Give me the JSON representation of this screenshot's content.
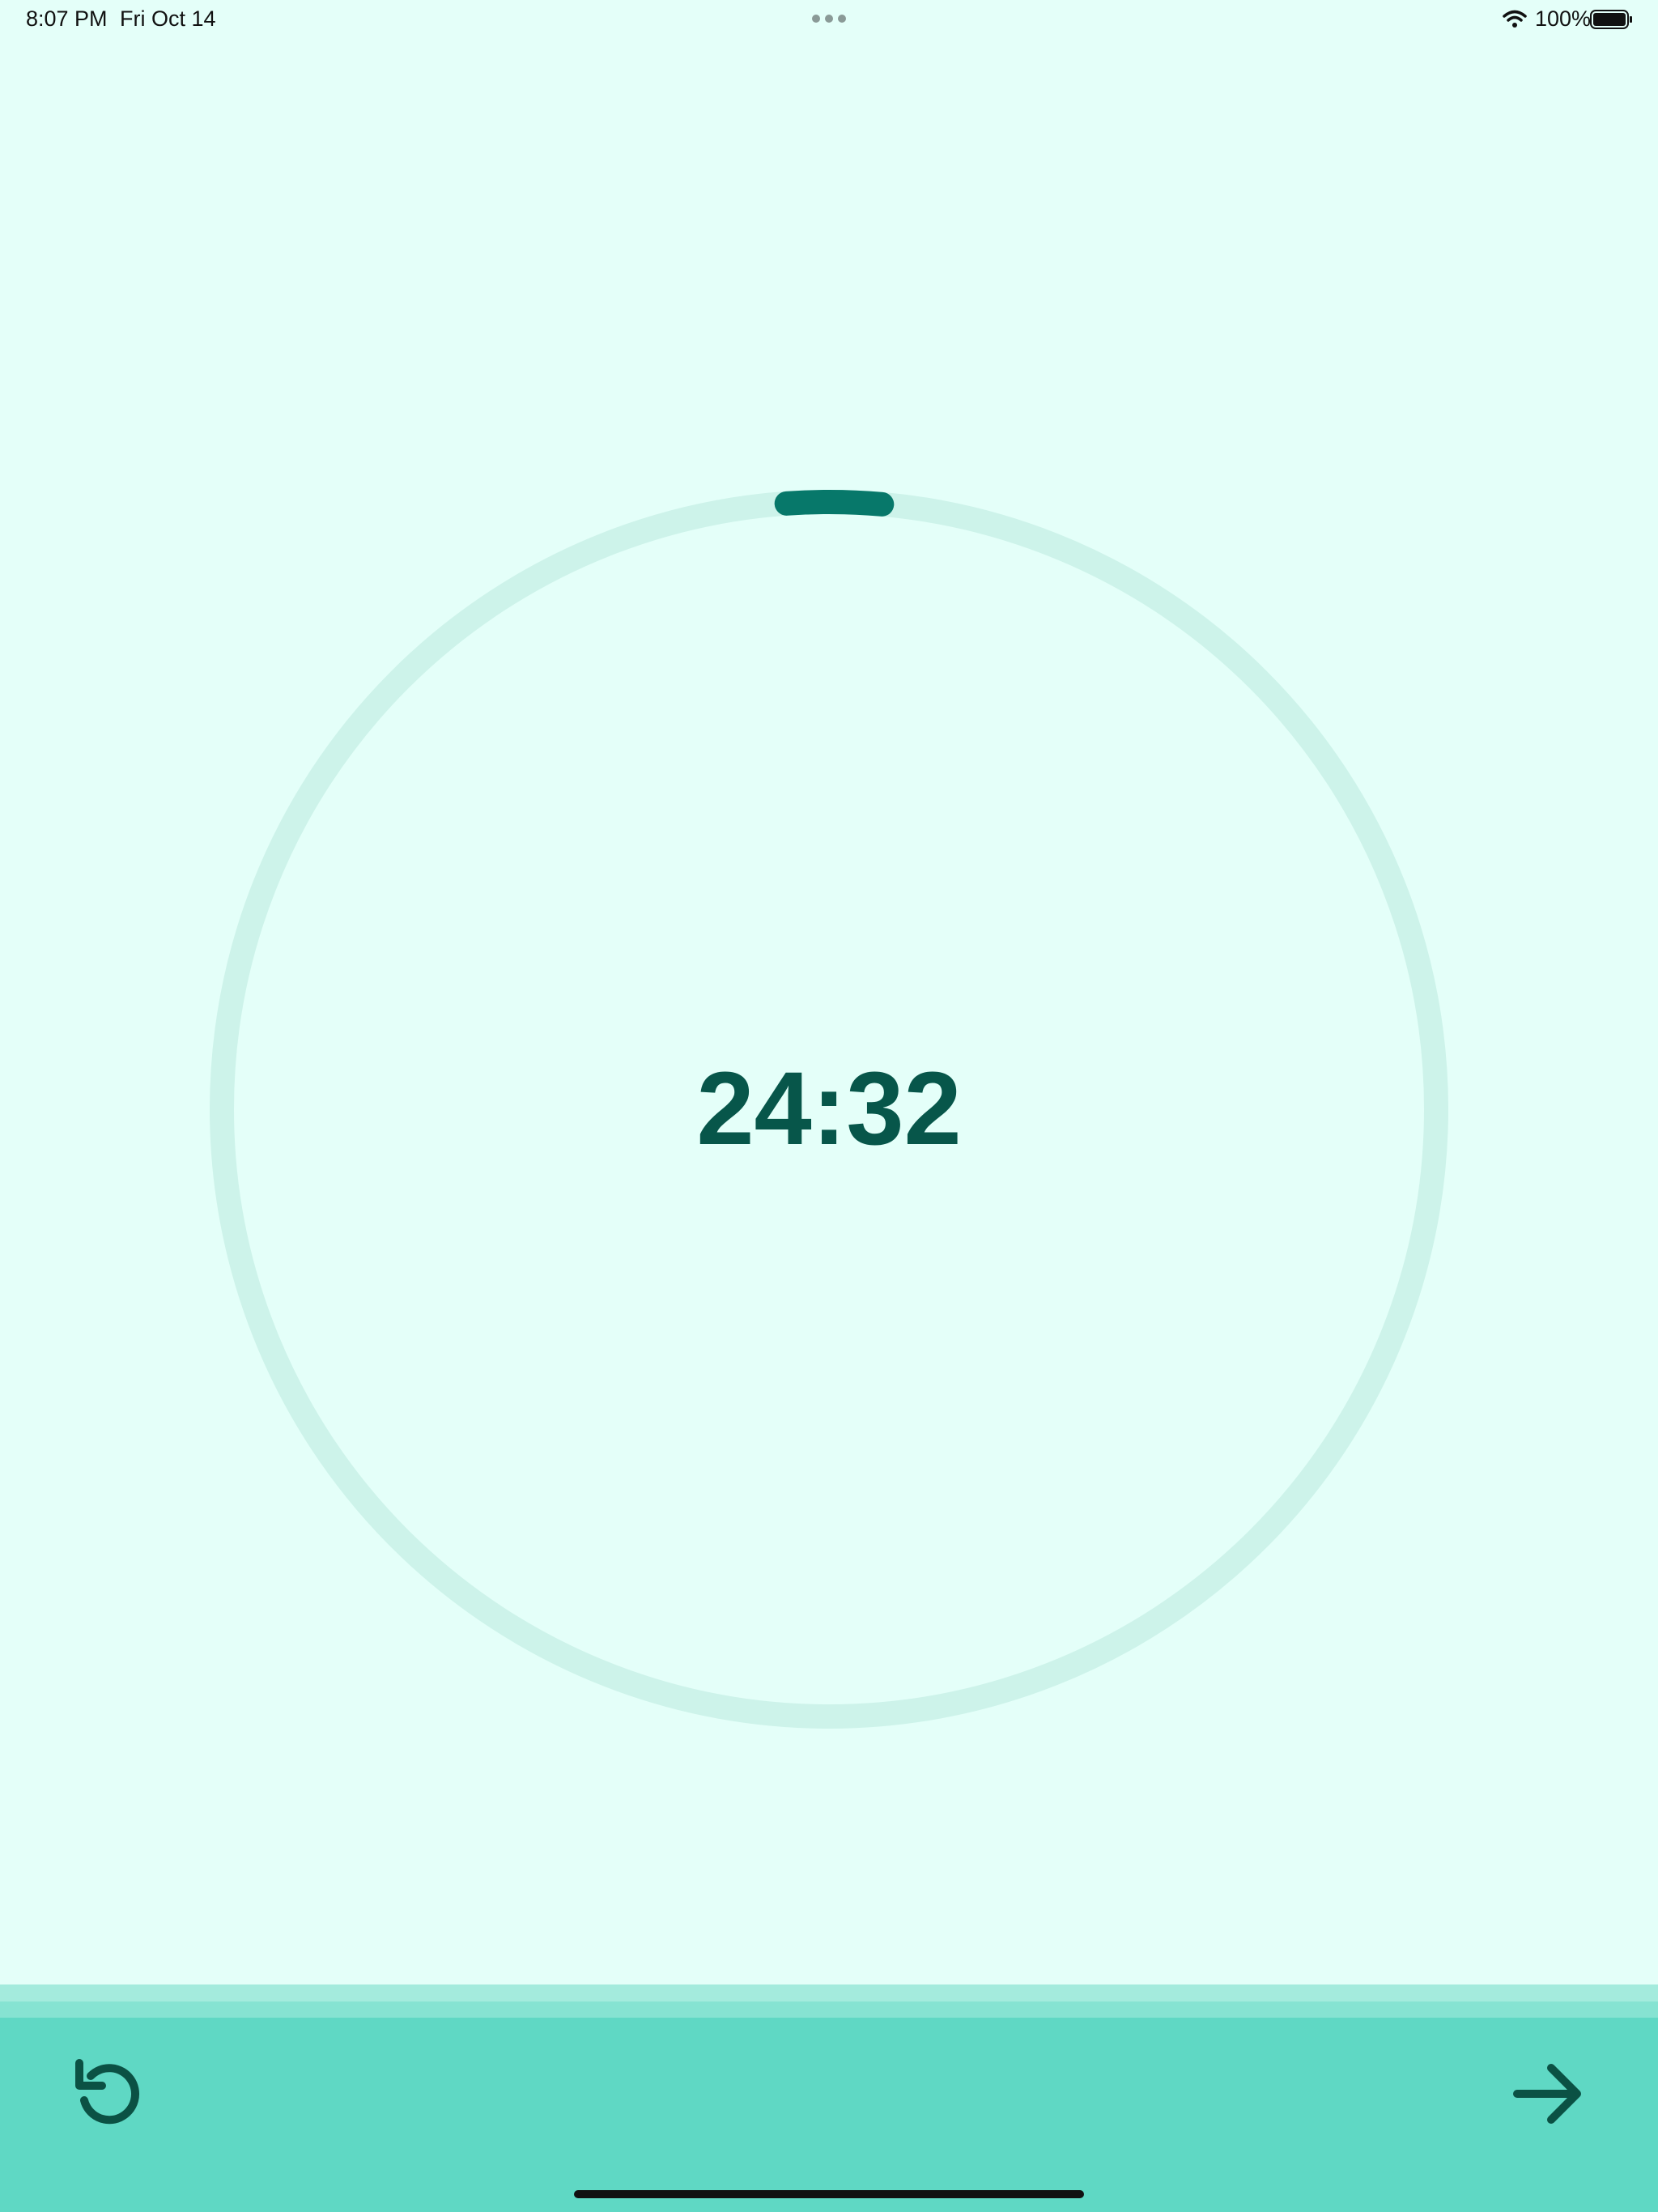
{
  "status_bar": {
    "time": "8:07 PM",
    "date": "Fri Oct 14",
    "battery_percent": "100%",
    "battery_level": 1.0,
    "icons": [
      "multitask-dots-icon",
      "wifi-icon",
      "battery-icon"
    ]
  },
  "timer": {
    "display": "24:32",
    "progress_fraction": 0.025
  },
  "toolbar": {
    "reset_icon": "reset-icon",
    "next_icon": "arrow-right-icon"
  },
  "colors": {
    "background": "#e4fff9",
    "ring_track": "#cdf3ea",
    "ring_progress": "#07786a",
    "timer_text": "#07564a",
    "toolbar": "#5fd8c4",
    "icon": "#0b5144"
  }
}
